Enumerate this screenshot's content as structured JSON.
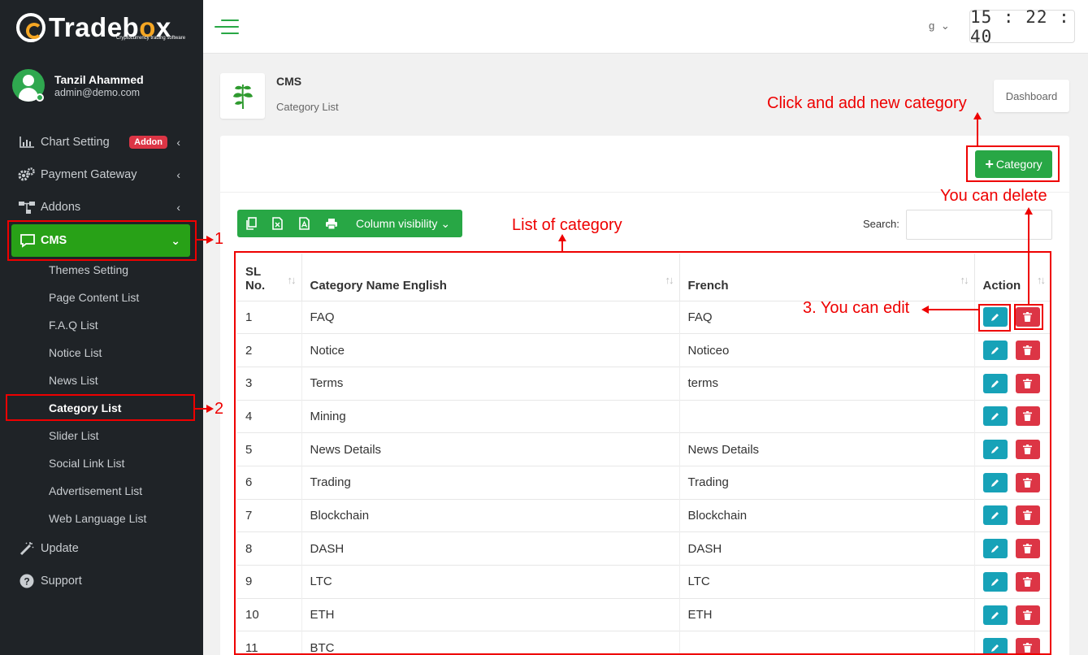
{
  "brand": {
    "name_prefix": "Trade",
    "name_o": "b",
    "name_suffix": "x",
    "o_letter": "o",
    "tagline": "Cryptocurrency trading software",
    "accent": "#f5a623"
  },
  "user": {
    "name": "Tanzil Ahammed",
    "email": "admin@demo.com"
  },
  "sidebar": {
    "items": [
      {
        "label": "Chart Setting",
        "icon": "bar-chart-icon",
        "badge": "Addon"
      },
      {
        "label": "Payment Gateway",
        "icon": "gears-icon"
      },
      {
        "label": "Addons",
        "icon": "sitemap-icon"
      },
      {
        "label": "CMS",
        "icon": "comment-icon"
      },
      {
        "label": "Update",
        "icon": "magic-wand-icon"
      },
      {
        "label": "Support",
        "icon": "question-icon"
      }
    ],
    "cms_sub": [
      "Themes Setting",
      "Page Content List",
      "F.A.Q List",
      "Notice List",
      "News List",
      "Category List",
      "Slider List",
      "Social Link List",
      "Advertisement List",
      "Web Language List"
    ]
  },
  "topbar": {
    "lang": "g",
    "clock": "15 : 22 : 40"
  },
  "page": {
    "title": "CMS",
    "subtitle": "Category List",
    "dashboard_btn": "Dashboard"
  },
  "card": {
    "add_button": "Category",
    "toolbar": {
      "column_visibility": "Column visibility"
    },
    "search_label": "Search:"
  },
  "table": {
    "headers": {
      "sl1": "SL",
      "sl2": "No.",
      "name_en": "Category Name English",
      "french": "French",
      "action": "Action"
    },
    "rows": [
      {
        "sl": "1",
        "en": "FAQ",
        "fr": "FAQ"
      },
      {
        "sl": "2",
        "en": "Notice",
        "fr": "Noticeo"
      },
      {
        "sl": "3",
        "en": "Terms",
        "fr": "terms"
      },
      {
        "sl": "4",
        "en": "Mining",
        "fr": ""
      },
      {
        "sl": "5",
        "en": "News Details",
        "fr": "News Details"
      },
      {
        "sl": "6",
        "en": "Trading",
        "fr": "Trading"
      },
      {
        "sl": "7",
        "en": "Blockchain",
        "fr": "Blockchain"
      },
      {
        "sl": "8",
        "en": "DASH",
        "fr": "DASH"
      },
      {
        "sl": "9",
        "en": "LTC",
        "fr": "LTC"
      },
      {
        "sl": "10",
        "en": "ETH",
        "fr": "ETH"
      },
      {
        "sl": "11",
        "en": "BTC",
        "fr": ""
      }
    ]
  },
  "annotations": {
    "n1": "1",
    "n2": "2",
    "add_new": "Click and add new category",
    "delete": "You can delete",
    "list": "List of category",
    "edit": "3. You can edit",
    "color": "#e00000"
  }
}
